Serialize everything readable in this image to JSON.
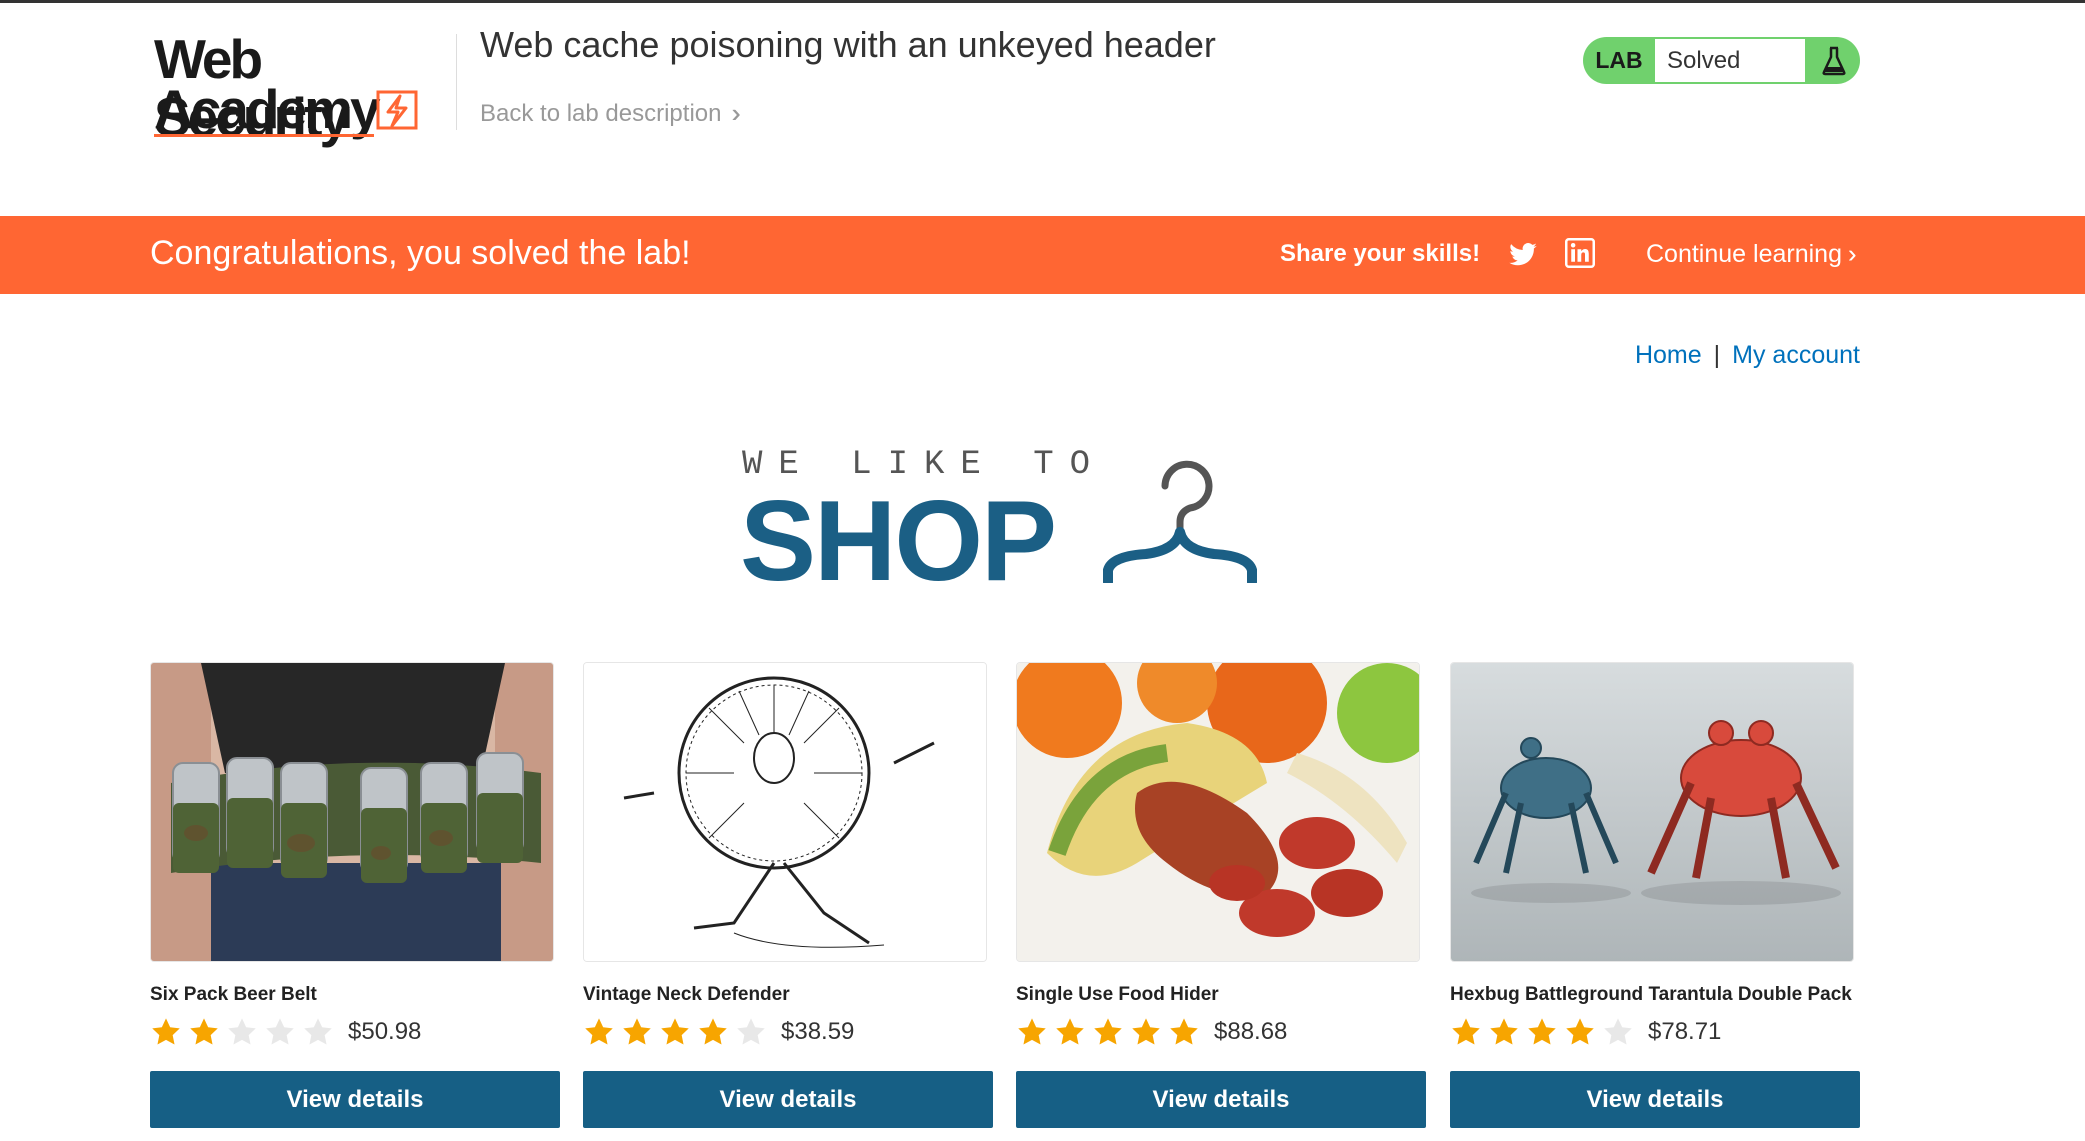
{
  "header": {
    "logo_line1": "Web Security",
    "logo_line2": "Academy",
    "lab_title": "Web cache poisoning with an unkeyed header",
    "back_link": "Back to lab description",
    "lab_tag": "LAB",
    "lab_status": "Solved"
  },
  "banner": {
    "message": "Congratulations, you solved the lab!",
    "share_label": "Share your skills!",
    "continue_label": "Continue learning",
    "color": "#ff6633"
  },
  "nav": {
    "home": "Home",
    "separator": "|",
    "account": "My account"
  },
  "shop_logo": {
    "tagline": "WE LIKE TO",
    "word": "SHOP"
  },
  "products": [
    {
      "name": "Six Pack Beer Belt",
      "rating": 2,
      "max_rating": 5,
      "price": "$50.98",
      "button": "View details"
    },
    {
      "name": "Vintage Neck Defender",
      "rating": 4,
      "max_rating": 5,
      "price": "$38.59",
      "button": "View details"
    },
    {
      "name": "Single Use Food Hider",
      "rating": 5,
      "max_rating": 5,
      "price": "$88.68",
      "button": "View details"
    },
    {
      "name": "Hexbug Battleground Tarantula Double Pack",
      "rating": 4,
      "max_rating": 5,
      "price": "$78.71",
      "button": "View details"
    }
  ],
  "colors": {
    "accent_orange": "#ff6633",
    "lab_green": "#70d16d",
    "link_blue": "#0071bc",
    "button_blue": "#165f85",
    "star_gold": "#f7a500"
  }
}
